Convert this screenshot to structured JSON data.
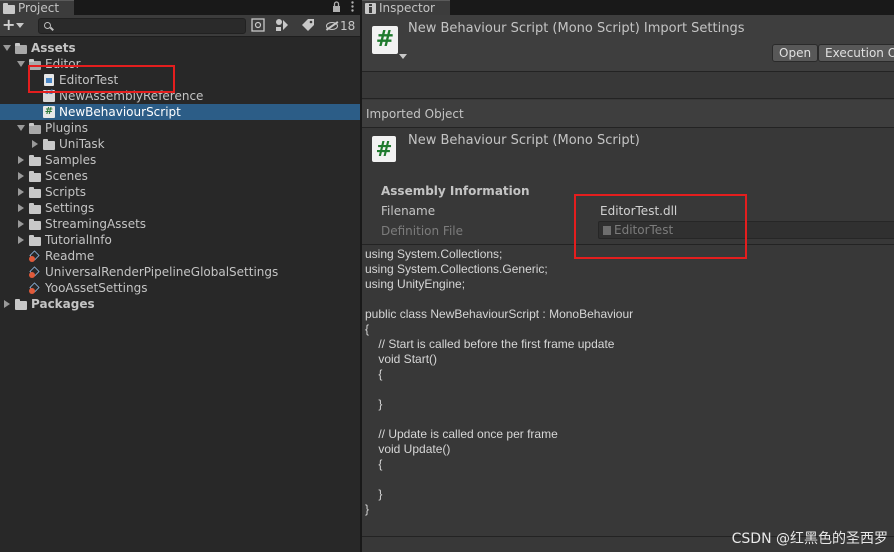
{
  "project": {
    "tab_label": "Project",
    "search": {
      "value": "",
      "placeholder": ""
    },
    "hidden_count": "18",
    "tree": [
      {
        "label": "Assets",
        "bold": true,
        "expanded": true,
        "icon": "folder-icon",
        "indent": 0
      },
      {
        "label": "Editor",
        "expanded": true,
        "icon": "folder-icon",
        "indent": 1
      },
      {
        "label": "EditorTest",
        "icon": "assembly-definition-icon",
        "indent": 2
      },
      {
        "label": "NewAssemblyReference",
        "icon": "assembly-reference-icon",
        "indent": 2
      },
      {
        "label": "NewBehaviourScript",
        "icon": "csharp-script-icon",
        "indent": 2,
        "selected": true
      },
      {
        "label": "Plugins",
        "expanded": true,
        "icon": "folder-icon",
        "indent": 1
      },
      {
        "label": "UniTask",
        "expanded": false,
        "icon": "folder-icon",
        "indent": 2
      },
      {
        "label": "Samples",
        "expanded": false,
        "icon": "folder-icon",
        "indent": 1
      },
      {
        "label": "Scenes",
        "expanded": false,
        "icon": "folder-icon",
        "indent": 1
      },
      {
        "label": "Scripts",
        "expanded": false,
        "icon": "folder-icon",
        "indent": 1
      },
      {
        "label": "Settings",
        "expanded": false,
        "icon": "folder-icon",
        "indent": 1
      },
      {
        "label": "StreamingAssets",
        "expanded": false,
        "icon": "folder-icon",
        "indent": 1
      },
      {
        "label": "TutorialInfo",
        "expanded": false,
        "icon": "folder-icon",
        "indent": 1
      },
      {
        "label": "Readme",
        "icon": "scriptable-object-icon",
        "indent": 1
      },
      {
        "label": "UniversalRenderPipelineGlobalSettings",
        "icon": "scriptable-object-icon",
        "indent": 1
      },
      {
        "label": "YooAssetSettings",
        "icon": "scriptable-object-icon",
        "indent": 1
      },
      {
        "label": "Packages",
        "bold": true,
        "expanded": false,
        "icon": "folder-icon",
        "indent": 0
      }
    ]
  },
  "inspector": {
    "tab_label": "Inspector",
    "header_title": "New Behaviour Script (Mono Script) Import Settings",
    "open_button": "Open",
    "execution_order_button": "Execution Or",
    "imported_object_label": "Imported Object",
    "imported_object_title": "New Behaviour Script (Mono Script)",
    "assembly": {
      "heading": "Assembly Information",
      "filename_label": "Filename",
      "filename_value": "EditorTest.dll",
      "definition_label": "Definition File",
      "definition_value": "EditorTest"
    },
    "code": "using System.Collections;\nusing System.Collections.Generic;\nusing UnityEngine;\n\npublic class NewBehaviourScript : MonoBehaviour\n{\n    // Start is called before the first frame update\n    void Start()\n    {\n\n    }\n\n    // Update is called once per frame\n    void Update()\n    {\n\n    }\n}"
  },
  "watermark": "CSDN @红黑色的圣西罗",
  "colors": {
    "selection": "#2c5d87",
    "highlight_box": "#e41e1e",
    "panel_bg": "#282828",
    "inspector_bg": "#383838"
  }
}
